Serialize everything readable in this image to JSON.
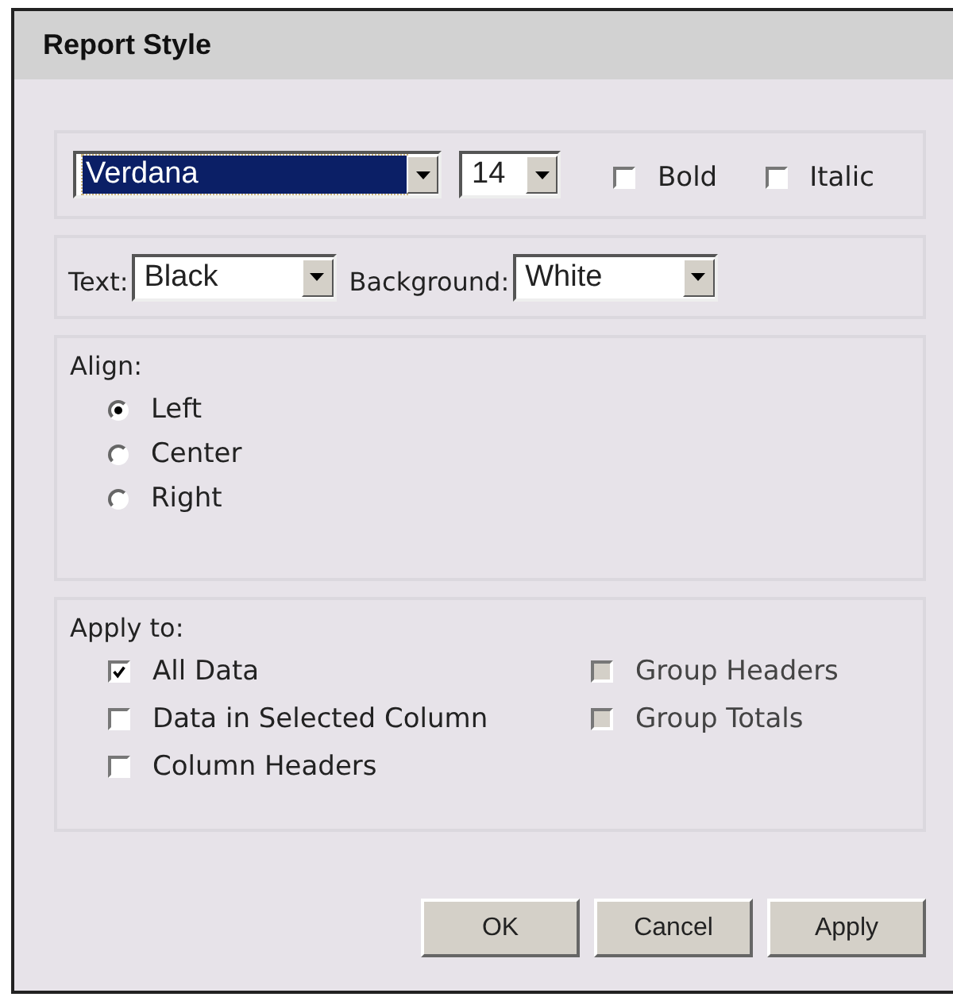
{
  "window": {
    "title": "Report Style"
  },
  "font": {
    "family": {
      "value": "Verdana",
      "focused": true
    },
    "size": {
      "value": "14",
      "focused": false
    },
    "styles": [
      {
        "label": "Bold",
        "checked": false
      },
      {
        "label": "Italic",
        "checked": false
      }
    ]
  },
  "colors": [
    {
      "label": "Text:",
      "value": "Black"
    },
    {
      "label": "Background:",
      "value": "White"
    }
  ],
  "align": {
    "label": "Align:",
    "options": [
      {
        "label": "Left",
        "selected": true
      },
      {
        "label": "Center",
        "selected": false
      },
      {
        "label": "Right",
        "selected": false
      }
    ]
  },
  "apply_to": {
    "label": "Apply to:",
    "options": [
      {
        "label": "All Data",
        "checked": true,
        "disabled": false
      },
      {
        "label": "Group Headers",
        "checked": false,
        "disabled": true
      },
      {
        "label": "Data in Selected Column",
        "checked": false,
        "disabled": false
      },
      {
        "label": "Group Totals",
        "checked": false,
        "disabled": true
      },
      {
        "label": "Column Headers",
        "checked": false,
        "disabled": false
      }
    ]
  },
  "buttons": [
    "OK",
    "Cancel",
    "Apply"
  ]
}
